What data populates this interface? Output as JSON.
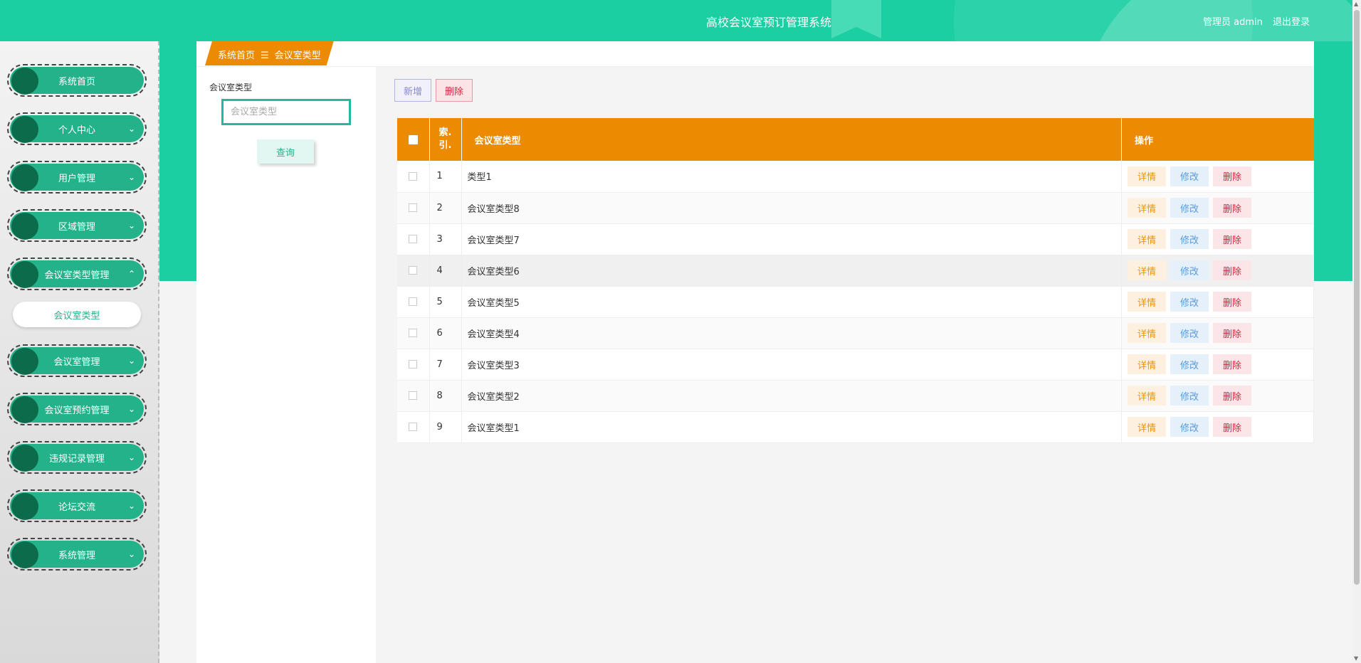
{
  "header": {
    "title": "高校会议室预订管理系统",
    "user_label": "管理员 admin",
    "logout_label": "退出登录"
  },
  "sidebar": {
    "items": [
      {
        "label": "系统首页",
        "chevron": ""
      },
      {
        "label": "个人中心",
        "chevron": "⌄"
      },
      {
        "label": "用户管理",
        "chevron": "⌄"
      },
      {
        "label": "区域管理",
        "chevron": "⌄"
      },
      {
        "label": "会议室类型管理",
        "chevron": "⌃"
      },
      {
        "label": "会议室管理",
        "chevron": "⌄"
      },
      {
        "label": "会议室预约管理",
        "chevron": "⌄"
      },
      {
        "label": "违规记录管理",
        "chevron": "⌄"
      },
      {
        "label": "论坛交流",
        "chevron": "⌄"
      },
      {
        "label": "系统管理",
        "chevron": "⌄"
      }
    ],
    "submenu": {
      "label": "会议室类型"
    }
  },
  "breadcrumb": {
    "home": "系统首页",
    "separator": "☰",
    "current": "会议室类型"
  },
  "search": {
    "label": "会议室类型",
    "placeholder": "会议室类型",
    "button": "查询"
  },
  "toolbar": {
    "add": "新增",
    "delete": "删除"
  },
  "table": {
    "headers": {
      "index_line1": "索",
      "index_line2": "引",
      "name": "会议室类型",
      "ops": "操作"
    },
    "rows": [
      {
        "index": "1",
        "name": "类型1"
      },
      {
        "index": "2",
        "name": "会议室类型8"
      },
      {
        "index": "3",
        "name": "会议室类型7"
      },
      {
        "index": "4",
        "name": "会议室类型6"
      },
      {
        "index": "5",
        "name": "会议室类型5"
      },
      {
        "index": "6",
        "name": "会议室类型4"
      },
      {
        "index": "7",
        "name": "会议室类型3"
      },
      {
        "index": "8",
        "name": "会议室类型2"
      },
      {
        "index": "9",
        "name": "会议室类型1"
      }
    ],
    "op_labels": {
      "detail": "详情",
      "edit": "修改",
      "remove": "删除"
    }
  },
  "colors": {
    "header": "#1bcfa3",
    "sidebar_item": "#24b28a",
    "table_header": "#ec8a02",
    "breadcrumb": "#ec8a02"
  }
}
